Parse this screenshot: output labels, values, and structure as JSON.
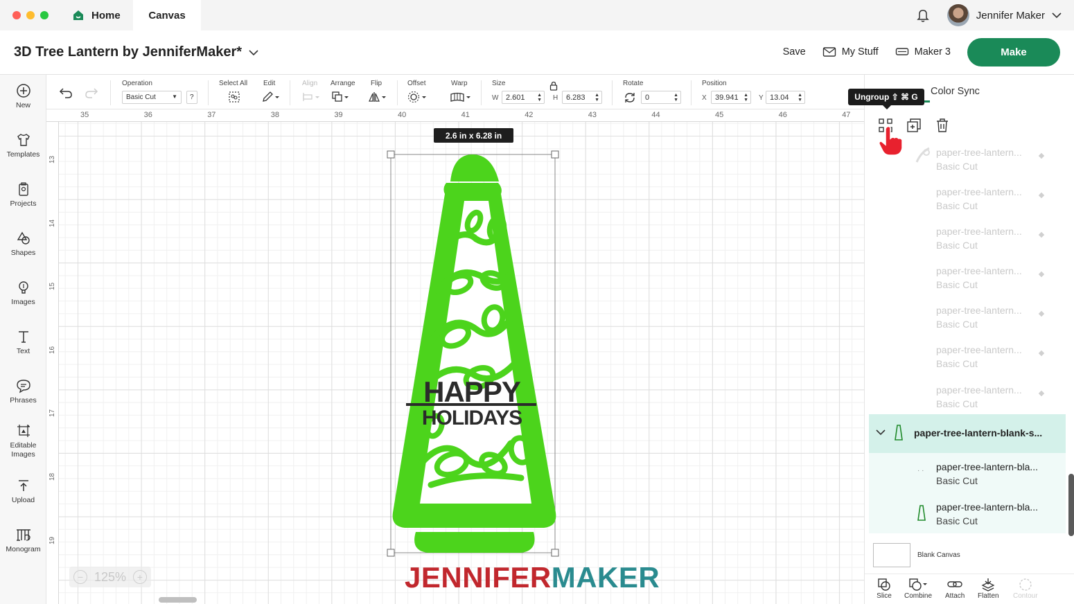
{
  "window": {
    "tabs": {
      "home": "Home",
      "canvas": "Canvas"
    },
    "user_name": "Jennifer Maker"
  },
  "project": {
    "title": "3D Tree Lantern by JenniferMaker*",
    "save_label": "Save",
    "my_stuff_label": "My Stuff",
    "machine_label": "Maker 3",
    "make_label": "Make"
  },
  "sidebar": {
    "items": [
      {
        "label": "New",
        "icon": "plus-circle-icon"
      },
      {
        "label": "Templates",
        "icon": "shirt-icon"
      },
      {
        "label": "Projects",
        "icon": "clipboard-icon"
      },
      {
        "label": "Shapes",
        "icon": "shapes-icon"
      },
      {
        "label": "Images",
        "icon": "lightbulb-icon"
      },
      {
        "label": "Text",
        "icon": "text-icon"
      },
      {
        "label": "Phrases",
        "icon": "speech-bubble-icon"
      },
      {
        "label": "Editable Images",
        "icon": "editable-image-icon"
      },
      {
        "label": "Upload",
        "icon": "upload-icon"
      },
      {
        "label": "Monogram",
        "icon": "monogram-icon"
      }
    ]
  },
  "toolbar": {
    "operation_label": "Operation",
    "operation_value": "Basic Cut",
    "help": "?",
    "select_all": "Select All",
    "edit": "Edit",
    "align": "Align",
    "arrange": "Arrange",
    "flip": "Flip",
    "offset": "Offset",
    "warp": "Warp",
    "size": "Size",
    "w_label": "W",
    "w_value": "2.601",
    "h_label": "H",
    "h_value": "6.283",
    "rotate": "Rotate",
    "rotate_value": "0",
    "position": "Position",
    "x_label": "X",
    "x_value": "39.941",
    "y_label": "Y",
    "y_value": "13.04"
  },
  "canvas": {
    "ruler_h": [
      "35",
      "36",
      "37",
      "38",
      "39",
      "40",
      "41",
      "42",
      "43",
      "44",
      "45",
      "46",
      "47"
    ],
    "ruler_v": [
      "13",
      "14",
      "15",
      "16",
      "17",
      "18",
      "19"
    ],
    "size_badge": "2.6  in x 6.28  in",
    "design_text_1": "HAPPY",
    "design_text_2": "HOLIDAYS",
    "zoom": "125%",
    "watermark_1": "JENNIFER",
    "watermark_2": "MAKER"
  },
  "right_panel": {
    "color_sync": "Color Sync",
    "tooltip": "Ungroup ⇧ ⌘ G",
    "faded_layers": [
      {
        "name": "paper-tree-lantern...",
        "op": "Basic Cut"
      },
      {
        "name": "paper-tree-lantern...",
        "op": "Basic Cut"
      },
      {
        "name": "paper-tree-lantern...",
        "op": "Basic Cut"
      },
      {
        "name": "paper-tree-lantern...",
        "op": "Basic Cut"
      },
      {
        "name": "paper-tree-lantern...",
        "op": "Basic Cut"
      },
      {
        "name": "paper-tree-lantern...",
        "op": "Basic Cut"
      },
      {
        "name": "paper-tree-lantern...",
        "op": "Basic Cut"
      }
    ],
    "group_name": "paper-tree-lantern-blank-s...",
    "group_children": [
      {
        "name": "paper-tree-lantern-bla...",
        "op": "Basic Cut"
      },
      {
        "name": "paper-tree-lantern-bla...",
        "op": "Basic Cut"
      }
    ],
    "blank_canvas": "Blank Canvas",
    "bottom_tools": {
      "slice": "Slice",
      "combine": "Combine",
      "attach": "Attach",
      "flatten": "Flatten",
      "contour": "Contour"
    }
  },
  "colors": {
    "accent": "#1a8a58",
    "design_green": "#4cd41c",
    "selected_group": "#d4f1ea",
    "watermark_red": "#c1272d",
    "watermark_teal": "#2a8b8f"
  }
}
